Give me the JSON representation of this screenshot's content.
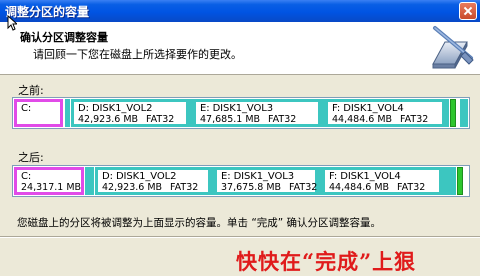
{
  "window": {
    "title": "调整分区的容量"
  },
  "header": {
    "title": "确认分区调整容量",
    "subtitle": "请回顾一下您在磁盘上所选择要作的更改。"
  },
  "before": {
    "label": "之前:",
    "partitions": [
      {
        "name": "C:",
        "size": "",
        "fs": "",
        "type": "c"
      },
      {
        "name": "D:  DISK1_VOL2",
        "size": "42,923.6 MB",
        "fs": "FAT32",
        "type": "normal"
      },
      {
        "name": "E:  DISK1_VOL3",
        "size": "47,685.1 MB",
        "fs": "FAT32",
        "type": "normal"
      },
      {
        "name": "F:  DISK1_VOL4",
        "size": "44,484.6 MB",
        "fs": "FAT32",
        "type": "normal"
      }
    ]
  },
  "after": {
    "label": "之后:",
    "partitions": [
      {
        "name": "C:",
        "size": "24,317.1 MB",
        "fs": "",
        "type": "c"
      },
      {
        "name": "D:  DISK1_VOL2",
        "size": "42,923.6 MB",
        "fs": "FAT32",
        "type": "normal"
      },
      {
        "name": "E:  DISK1_VOL3",
        "size": "37,675.8 MB",
        "fs": "FAT32",
        "type": "normal"
      },
      {
        "name": "F:  DISK1_VOL4",
        "size": "44,484.6 MB",
        "fs": "FAT32",
        "type": "normal"
      }
    ]
  },
  "status_text": "您磁盘上的分区将被调整为上面显示的容量。单击 “完成” 确认分区调整容量。",
  "overlay_text": "快快在“完成”上狠",
  "colors": {
    "partition_border": "#3CC6C0",
    "c_partition_border": "#E14BE8",
    "green_bar": "#2EC62E",
    "overlay": "#E01B1B"
  }
}
